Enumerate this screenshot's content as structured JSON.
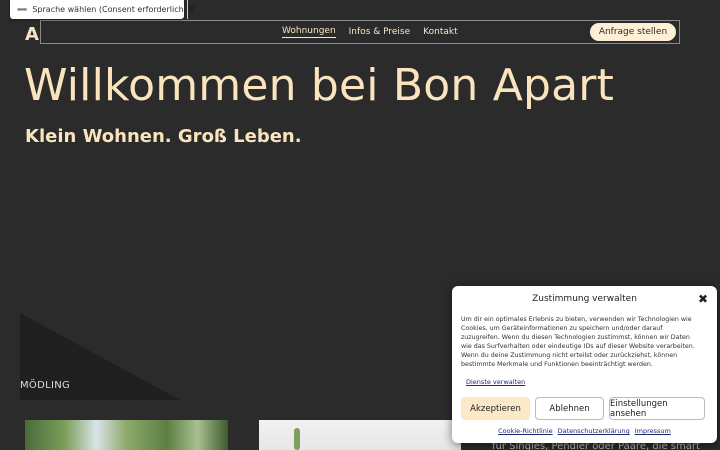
{
  "language_selector": {
    "flag": "▬▬",
    "label": "Sprache wählen (Consent erforderlich)",
    "arrow": "▼"
  },
  "logo": {
    "text": "Ap"
  },
  "nav": {
    "links": [
      "Wohnungen",
      "Infos & Preise",
      "Kontakt"
    ],
    "cta": "Anfrage stellen"
  },
  "hero": {
    "title": "Willkommen bei Bon Apart",
    "subtitle": "Klein Wohnen. Groß Leben."
  },
  "location": {
    "label": "MÖDLING"
  },
  "body_fragment": "für Singles, Pendler oder Paare, die smart",
  "consent": {
    "title": "Zustimmung verwalten",
    "close": "✖",
    "text": "Um dir ein optimales Erlebnis zu bieten, verwenden wir Technologien wie Cookies, um Geräteinformationen zu speichern und/oder darauf zuzugreifen. Wenn du diesen Technologien zustimmst, können wir Daten wie das Surfverhalten oder eindeutige IDs auf dieser Website verarbeiten. Wenn du deine Zustimmung nicht erteilst oder zurückziehst, können bestimmte Merkmale und Funktionen beeinträchtigt werden.",
    "services_link": "Dienste verwalten",
    "buttons": {
      "accept": "Akzeptieren",
      "deny": "Ablehnen",
      "settings": "Einstellungen ansehen"
    },
    "links": [
      "Cookie-Richtlinie",
      "Datenschutzerklärung",
      "Impressum"
    ]
  }
}
